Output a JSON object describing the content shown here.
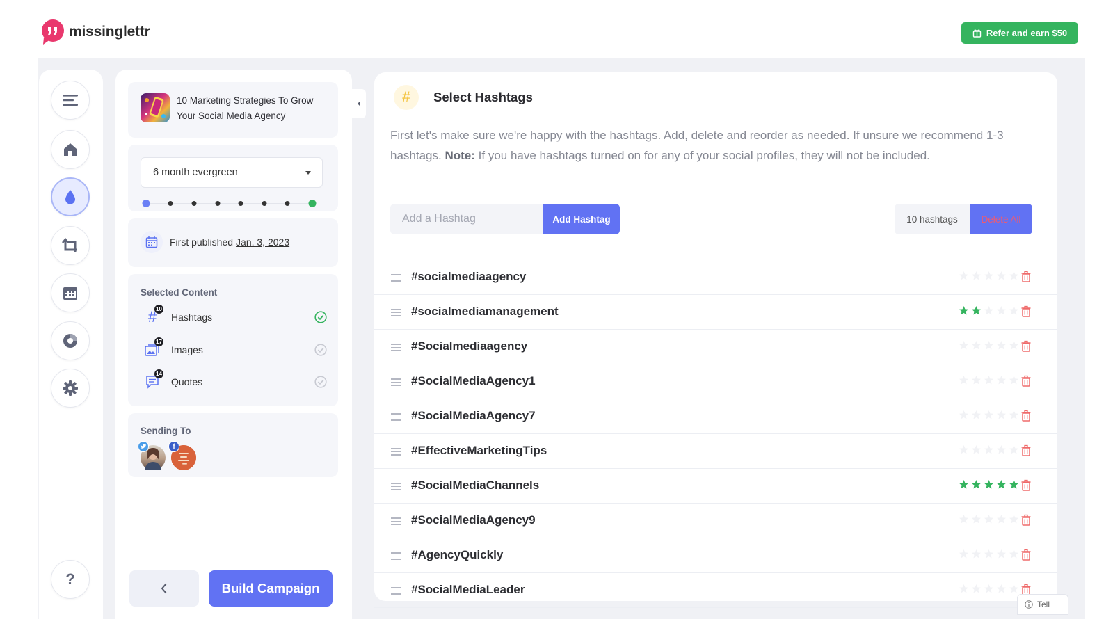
{
  "brand": {
    "name": "missinglettr",
    "color": "#e9386d"
  },
  "header": {
    "refer_label": "Refer and earn $50",
    "refer_color": "#35b45f"
  },
  "rail": {
    "items": [
      {
        "name": "menu-icon"
      },
      {
        "name": "home-icon"
      },
      {
        "name": "drip-icon",
        "active": true
      },
      {
        "name": "repeat-icon"
      },
      {
        "name": "calendar-icon"
      },
      {
        "name": "analytics-icon"
      },
      {
        "name": "settings-icon"
      }
    ],
    "help_label": "?"
  },
  "campaign": {
    "title": "10 Marketing Strategies To Grow Your Social Media Agency",
    "schedule": "6 month evergreen",
    "schedule_steps": 8,
    "published_prefix": "First published",
    "published_date": "Jan. 3, 2023"
  },
  "selected_content": {
    "title": "Selected Content",
    "items": [
      {
        "label": "Hashtags",
        "count": "10",
        "icon": "hashtag-icon",
        "selected": true
      },
      {
        "label": "Images",
        "count": "17",
        "icon": "images-icon",
        "selected": false
      },
      {
        "label": "Quotes",
        "count": "14",
        "icon": "quotes-icon",
        "selected": false
      }
    ]
  },
  "sending_to": {
    "title": "Sending To",
    "accounts": [
      {
        "network": "twitter",
        "badge_color": "#4a9de9"
      },
      {
        "network": "facebook",
        "badge_color": "#3b5fc9"
      }
    ]
  },
  "footer_buttons": {
    "back_icon": "chevron-left-icon",
    "build_label": "Build Campaign"
  },
  "hashtags": {
    "title": "Select Hashtags",
    "description_a": "First let's make sure we're happy with the hashtags. Add, delete and reorder as needed. If unsure we recommend 1-3 hashtags.",
    "note_label": "Note:",
    "description_b": "If you have hashtags turned on for any of your social profiles, they will not be included.",
    "input_placeholder": "Add a Hashtag",
    "add_label": "Add Hashtag",
    "count_label": "10 hashtags",
    "delete_all_label": "Delete All",
    "star_color": "#35b45f",
    "list": [
      {
        "tag": "#socialmediaagency",
        "rating": 0
      },
      {
        "tag": "#socialmediamanagement",
        "rating": 2
      },
      {
        "tag": "#Socialmediaagency",
        "rating": 0
      },
      {
        "tag": "#SocialMediaAgency1",
        "rating": 0
      },
      {
        "tag": "#SocialMediaAgency7",
        "rating": 0
      },
      {
        "tag": "#EffectiveMarketingTips",
        "rating": 0
      },
      {
        "tag": "#SocialMediaChannels",
        "rating": 5
      },
      {
        "tag": "#SocialMediaAgency9",
        "rating": 0
      },
      {
        "tag": "#AgencyQuickly",
        "rating": 0
      },
      {
        "tag": "#SocialMediaLeader",
        "rating": 0
      }
    ]
  },
  "feedback": {
    "label": "Tell"
  }
}
